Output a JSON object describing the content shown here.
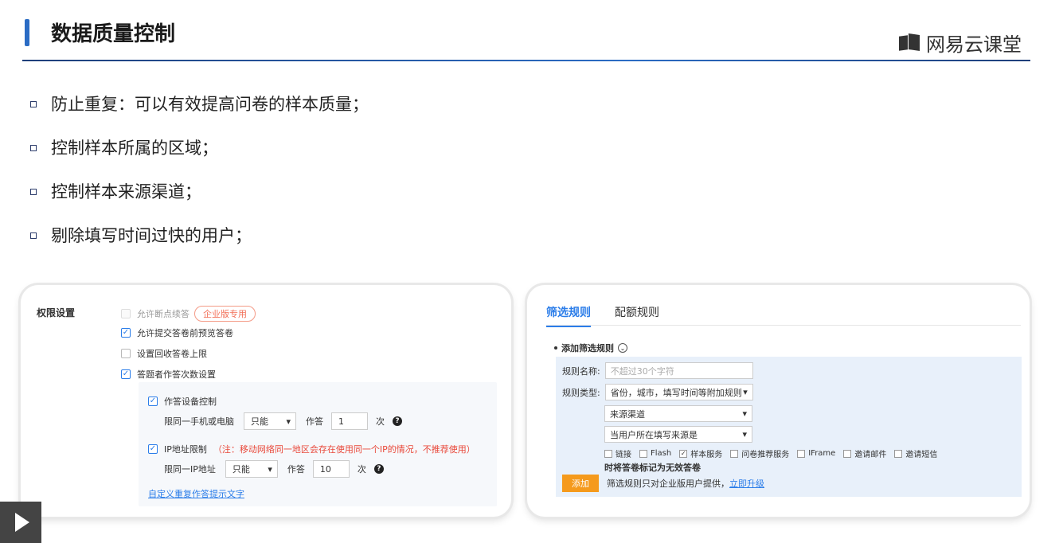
{
  "header": {
    "title": "数据质量控制",
    "brand": "网易云课堂",
    "accent": "#2b6cc4"
  },
  "bullets": [
    "防止重复：可以有效提高问卷的样本质量；",
    "控制样本所属的区域；",
    "控制样本来源渠道；",
    "剔除填写时间过快的用户；"
  ],
  "permissions": {
    "section_label": "权限设置",
    "items": [
      {
        "label": "允许断点续答",
        "checked": false,
        "disabled": true,
        "tag": "企业版专用"
      },
      {
        "label": "允许提交答卷前预览答卷",
        "checked": true
      },
      {
        "label": "设置回收答卷上限",
        "checked": false
      },
      {
        "label": "答题者作答次数设置",
        "checked": true
      }
    ],
    "device": {
      "label": "作答设备控制",
      "row_label": "限同一手机或电脑",
      "select_value": "只能",
      "mid_label": "作答",
      "count": "1",
      "unit": "次"
    },
    "ip": {
      "label": "IP地址限制",
      "note": "（注：移动网络同一地区会存在使用同一个IP的情况，不推荐使用）",
      "row_label": "限同一IP地址",
      "select_value": "只能",
      "mid_label": "作答",
      "count": "10",
      "unit": "次"
    },
    "custom_link": "自定义重复作答提示文字"
  },
  "filter": {
    "tabs": [
      "筛选规则",
      "配额规则"
    ],
    "add_rule": "添加筛选规则",
    "name_label": "规则名称:",
    "name_placeholder": "不超过30个字符",
    "type_label": "规则类型:",
    "type_select": "省份，城市，填写时间等附加规则",
    "source_select": "来源渠道",
    "condition_select": "当用户所在填写来源是",
    "channels": [
      {
        "label": "链接",
        "checked": false
      },
      {
        "label": "Flash",
        "checked": false
      },
      {
        "label": "样本服务",
        "checked": true
      },
      {
        "label": "问卷推荐服务",
        "checked": false
      },
      {
        "label": "IFrame",
        "checked": false
      },
      {
        "label": "邀请邮件",
        "checked": false
      },
      {
        "label": "邀请短信",
        "checked": false
      }
    ],
    "mark_text": "时将答卷标记为无效答卷",
    "add_button": "添加",
    "footer_text": "筛选规则只对企业版用户提供，",
    "upgrade_link": "立即升级"
  }
}
